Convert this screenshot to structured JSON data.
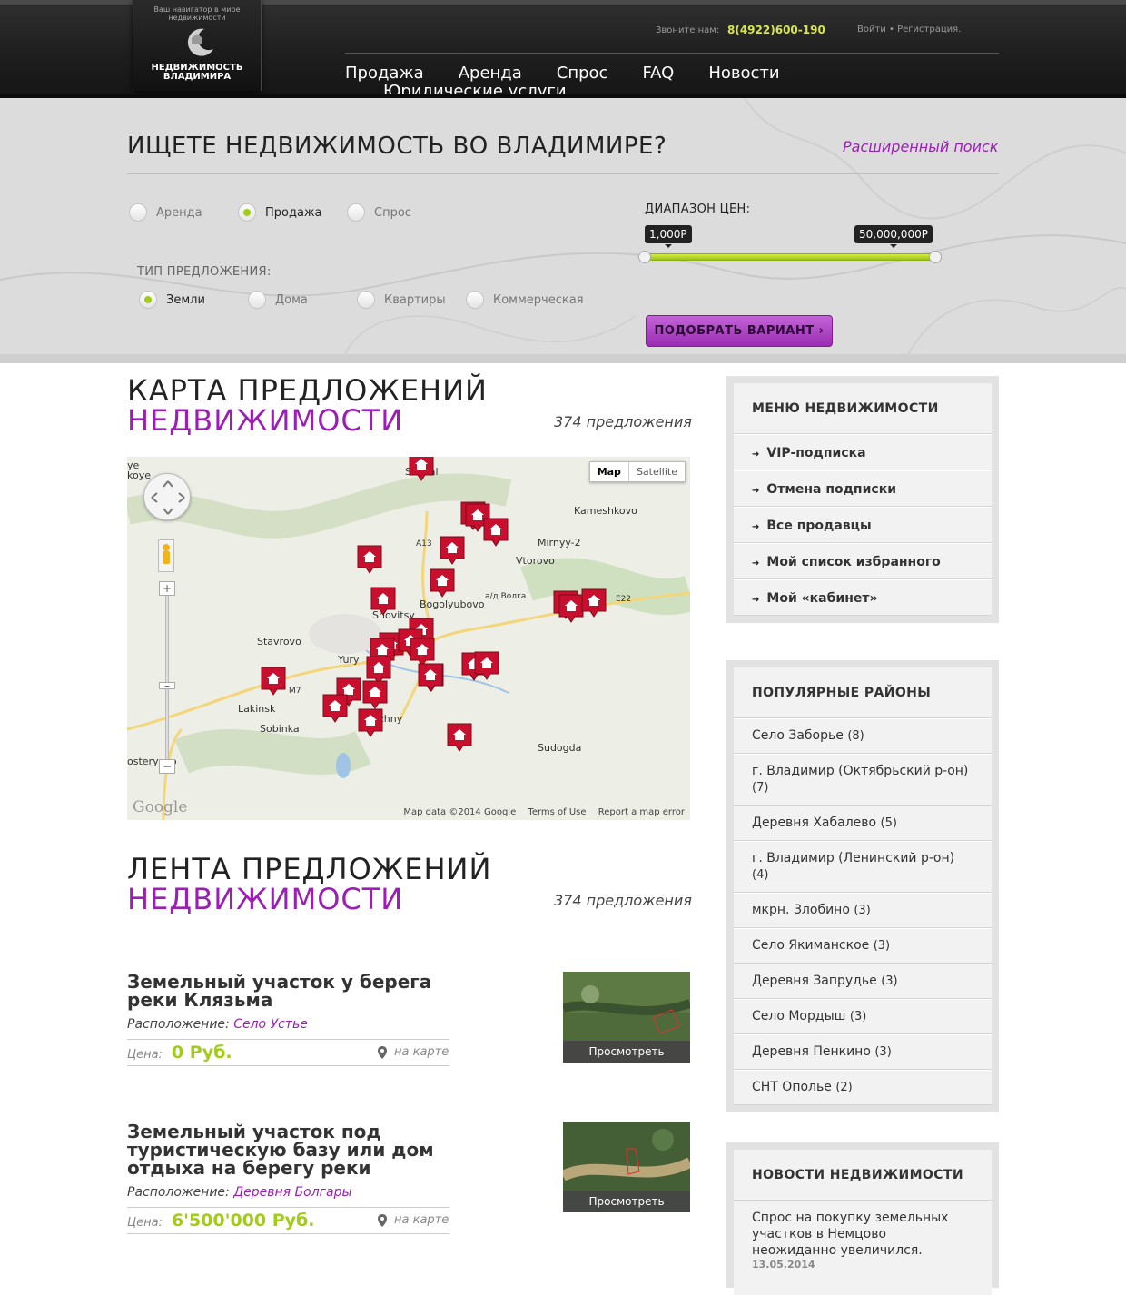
{
  "header": {
    "logo_tagline": "Ваш навигатор в мире недвижимости",
    "logo_name_line1": "НЕДВИЖИМОСТЬ",
    "logo_name_line2": "ВЛАДИМИРА",
    "phone_label": "Звоните нам:",
    "phone": "8(4922)600-190",
    "login": "Войти",
    "auth_sep": "•",
    "register": "Регистрация.",
    "nav": [
      "Продажа",
      "Аренда",
      "Спрос",
      "FAQ",
      "Новости"
    ],
    "nav_legal": "Юридические услуги"
  },
  "search": {
    "title": "ИЩЕТЕ НЕДВИЖИМОСТЬ ВО ВЛАДИМИРЕ?",
    "advanced_link": "Расширенный поиск",
    "deal_options": [
      {
        "label": "Аренда",
        "selected": false
      },
      {
        "label": "Продажа",
        "selected": true
      },
      {
        "label": "Спрос",
        "selected": false
      }
    ],
    "type_label": "ТИП ПРЕДЛОЖЕНИЯ:",
    "type_options": [
      {
        "label": "Земли",
        "selected": true
      },
      {
        "label": "Дома",
        "selected": false
      },
      {
        "label": "Квартиры",
        "selected": false
      },
      {
        "label": "Коммерческая",
        "selected": false
      }
    ],
    "price_label": "ДИАПАЗОН ЦЕН:",
    "price_min": "1,000Р",
    "price_max": "50,000,000Р",
    "submit": "ПОДОБРАТЬ ВАРИАНТ",
    "submit_arrow": "›"
  },
  "map_section": {
    "title_line1": "КАРТА ПРЕДЛОЖЕНИЙ",
    "title_line2": "НЕДВИЖИМОСТИ",
    "count": "374 предложения",
    "map_button": "Map",
    "satellite_button": "Satellite",
    "footer_data": "Map data ©2014 Google",
    "footer_terms": "Terms of Use",
    "footer_report": "Report a map error",
    "google": "Google",
    "places": [
      "Suzdal",
      "Kameshkovo",
      "Mirnyy-2",
      "Vtorovo",
      "Bogolyubovo",
      "Stavrovo",
      "Lakinsk",
      "Sobinka",
      "Sudogda",
      "Snovitsy",
      "Yury",
      "uzhny",
      "A13",
      "M7",
      "E22",
      "а/д Волга",
      "ye",
      "koye",
      "osteryovo"
    ]
  },
  "feed_section": {
    "title_line1": "ЛЕНТА ПРЕДЛОЖЕНИЙ",
    "title_line2": "НЕДВИЖИМОСТИ",
    "count": "374 предложения"
  },
  "listings": [
    {
      "title": "Земельный участок у берега реки Клязьма",
      "loc_label": "Расположение:",
      "location": "Село Устье",
      "price_label": "Цена:",
      "price": "0 Руб.",
      "on_map": "на карте",
      "view": "Просмотреть"
    },
    {
      "title": "Земельный участок под туристическую базу или дом отдыха на берегу реки",
      "loc_label": "Расположение:",
      "location": "Деревня Болгары",
      "price_label": "Цена:",
      "price": "6'500'000 Руб.",
      "on_map": "на карте",
      "view": "Просмотреть"
    }
  ],
  "sidebar": {
    "menu_title": "МЕНЮ НЕДВИЖИМОСТИ",
    "menu": [
      "VIP-подписка",
      "Отмена подписки",
      "Все продавцы",
      "Мой список избранного",
      "Мой «кабинет»"
    ],
    "districts_title": "ПОПУЛЯРНЫЕ РАЙОНЫ",
    "districts": [
      {
        "name": "Село Заборье",
        "count": "(8)"
      },
      {
        "name": "г. Владимир (Октябрьский р-он)",
        "count": "(7)"
      },
      {
        "name": "Деревня Хабалево",
        "count": "(5)"
      },
      {
        "name": "г. Владимир (Ленинский р-он)",
        "count": "(4)"
      },
      {
        "name": "мкрн. Злобино",
        "count": "(3)"
      },
      {
        "name": "Село Якиманское",
        "count": "(3)"
      },
      {
        "name": "Деревня Запрудье",
        "count": "(3)"
      },
      {
        "name": "Село Мордыш",
        "count": "(3)"
      },
      {
        "name": "Деревня Пенкино",
        "count": "(3)"
      },
      {
        "name": "СНТ Ополье",
        "count": "(2)"
      }
    ],
    "news_title": "НОВОСТИ НЕДВИЖИМОСТИ",
    "news_text": "Спрос на покупку земельных участков в Немцово неожиданно увеличился.",
    "news_date": "13.05.2014"
  },
  "colors": {
    "accent_purple": "#9b1fb5",
    "accent_green": "#a3cc19",
    "phone_yellow": "#d9e64a",
    "marker_red": "#c8102e"
  }
}
